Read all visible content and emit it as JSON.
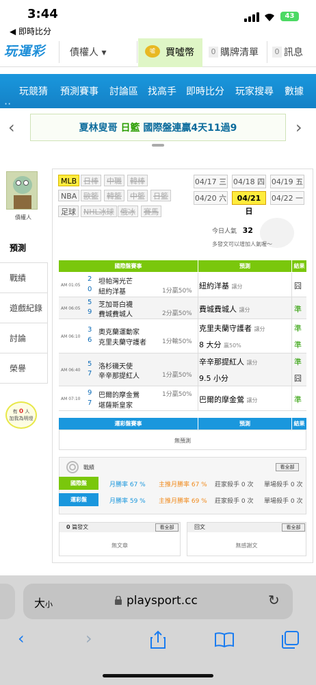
{
  "status": {
    "time": "3:44",
    "back_app": "◀ 即時比分",
    "battery": "43"
  },
  "nav": {
    "logo": "玩運彩",
    "creditor": "債權人 ▾",
    "buy_coin": "買噓幣",
    "coin_icon_text": "噓",
    "cart_count": "0",
    "cart": "購牌清單",
    "msg_count": "0",
    "msg": "訊息"
  },
  "menu": [
    "玩競猜",
    "預測賽事",
    "討論區",
    "找高手",
    "即時比分",
    "玩家搜尋",
    "數據"
  ],
  "banner": {
    "name": "夏林叟哥",
    "league": "日籃",
    "text": "國際盤連贏4天11過9"
  },
  "profile": {
    "label": "債權人"
  },
  "tabs": [
    "預測",
    "戰績",
    "遊戲紀錄",
    "討論",
    "榮譽"
  ],
  "bulb": {
    "line1": "有",
    "count": "0",
    "unit": "人",
    "line2": "加我為明燈"
  },
  "filters": {
    "row1": [
      "MLB",
      "日棒",
      "中職",
      "韓棒"
    ],
    "row2": [
      "NBA",
      "歐籃",
      "韓籃",
      "中籃",
      "日籃"
    ],
    "row3": [
      "足球",
      "NHL冰球",
      "俄冰",
      "賽馬"
    ]
  },
  "dates": [
    "04/17 三",
    "04/18 四",
    "04/19 五",
    "04/20 六",
    "04/21 日",
    "04/22 一"
  ],
  "popularity": {
    "label": "今日人氣",
    "value": "32",
    "note": "多發文可以增加人氣喔～"
  },
  "intl_table": {
    "title": "國際盤賽事",
    "col_pick": "預測",
    "col_result": "結果"
  },
  "games": [
    {
      "time": "AM 01:05",
      "n1": "2",
      "t1": "坦帕灣光芒",
      "n2": "0",
      "t2": "紐約洋基",
      "odds": "1分贏50%",
      "pick": "紐約洋基",
      "pick_type": "讓分",
      "result": "囧"
    },
    {
      "time": "AM 06:05",
      "n1": "5",
      "t1": "芝加哥白襪",
      "n2": "9",
      "t2": "費城費城人",
      "odds": "2分贏50%",
      "pick": "費城費城人",
      "pick_type": "讓分",
      "result": "準"
    },
    {
      "time": "AM 06:10",
      "n1": "3",
      "t1": "奧克蘭運動家",
      "n2": "6",
      "t2": "克里夫蘭守護者",
      "odds": "1分輸50%",
      "pick": "克里夫蘭守護者",
      "pick_type": "讓分",
      "pick2": "8 大分",
      "pick2_type": "贏50%",
      "result": "準",
      "result2": "準"
    },
    {
      "time": "AM 06:40",
      "n1": "5",
      "t1": "洛杉磯天使",
      "n2": "7",
      "t2": "辛辛那提紅人",
      "odds": "1分贏50%",
      "pick": "辛辛那提紅人",
      "pick_type": "讓分",
      "pick2": "9.5 小分",
      "pick2_type": "",
      "result": "準",
      "result2": "囧"
    },
    {
      "time": "AM 07:10",
      "n1": "9",
      "t1": "巴爾的摩金鶯",
      "n2": "7",
      "t2": "堪薩斯皇家",
      "odds": "1分贏50%",
      "pick": "巴爾的摩金鶯",
      "pick_type": "讓分",
      "result": "準"
    }
  ],
  "lottery_table": {
    "title": "運彩盤賽事",
    "col_pick": "預測",
    "col_result": "結果",
    "empty": "無預測"
  },
  "stats": {
    "title": "戰績",
    "see_all": "看全部",
    "intl": {
      "label": "國際盤",
      "month": "月勝率 67 %",
      "main": "主推月勝率 67 %",
      "killer": "莊家殺手 0 次",
      "single": "單場殺手 0 次"
    },
    "lottery": {
      "label": "運彩盤",
      "month": "月勝率 59 %",
      "main": "主推月勝率 69 %",
      "killer": "莊家殺手 0 次",
      "single": "單場殺手 0 次"
    }
  },
  "posts": {
    "count": "0",
    "label": "篇發文",
    "see_all": "看全部",
    "empty": "無文章"
  },
  "replies": {
    "label": "回文",
    "see_all": "看全部",
    "empty": "無感謝文"
  },
  "browser": {
    "aa": "大",
    "aa_small": "小",
    "url": "playsport.cc"
  },
  "colors": {
    "green": "#7ac70c",
    "blue": "#1a97dd",
    "yellow": "#ffec3d"
  }
}
